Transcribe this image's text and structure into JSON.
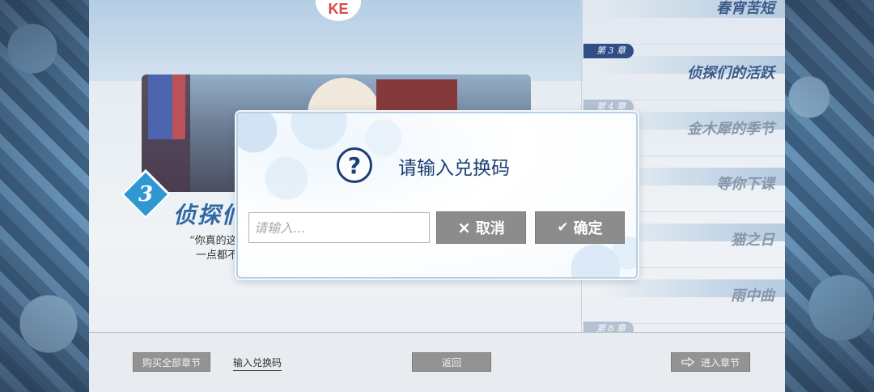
{
  "logo": {
    "text": "KE"
  },
  "featured": {
    "chapter_number": "3",
    "title": "侦探们",
    "quote_line1": "“你真的这",
    "quote_line2": "一点都不"
  },
  "chapter_list": [
    {
      "tag": "",
      "name": "春宵苦短",
      "muted": false
    },
    {
      "tag": "第 3 章",
      "name": "侦探们的活跃",
      "muted": false
    },
    {
      "tag": "第 4 章",
      "name": "金木犀的季节",
      "muted": true
    },
    {
      "tag": "",
      "name": "等你下课",
      "muted": true
    },
    {
      "tag": "",
      "name": "猫之日",
      "muted": true
    },
    {
      "tag": "",
      "name": "雨中曲",
      "muted": true
    },
    {
      "tag": "第 8 章",
      "name": "",
      "muted": true
    }
  ],
  "bottom_bar": {
    "buy_all": "购买全部章节",
    "redeem_link": "输入兑换码",
    "back": "返回",
    "enter": "进入章节",
    "enter_icon": "arrow-right-outline-icon"
  },
  "dialog": {
    "icon": "question-circle-icon",
    "title": "请输入兑换码",
    "input_value": "",
    "input_placeholder": "请输入...",
    "cancel_icon": "×",
    "cancel_label": "取消",
    "confirm_icon": "✔",
    "confirm_label": "确定"
  }
}
